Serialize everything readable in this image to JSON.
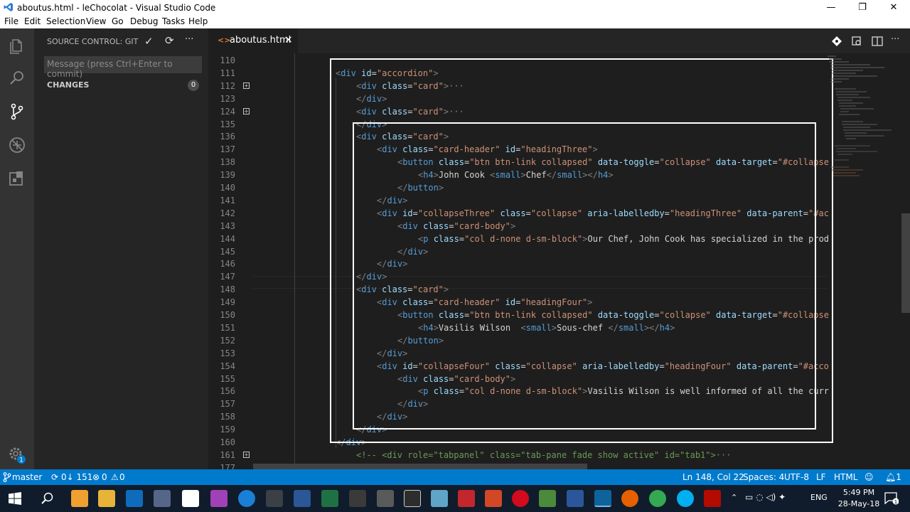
{
  "window": {
    "title": "aboutus.html - leChocolat - Visual Studio Code",
    "minimize": "—",
    "maximize": "❐",
    "close": "✕"
  },
  "menu": [
    "File",
    "Edit",
    "Selection",
    "View",
    "Go",
    "Debug",
    "Tasks",
    "Help"
  ],
  "sidebar": {
    "header": "SOURCE CONTROL: GIT",
    "commit_placeholder": "Message (press Ctrl+Enter to commit)",
    "changes_label": "CHANGES",
    "changes_count": "0",
    "check_glyph": "✓",
    "refresh_glyph": "⟳",
    "more_glyph": "···"
  },
  "tab": {
    "icon": "<>",
    "label": "aboutus.html",
    "close": "×"
  },
  "editor": {
    "lines": [
      {
        "n": "110",
        "indent": 0,
        "parts": []
      },
      {
        "n": "111",
        "indent": 0,
        "parts": [
          [
            "pu",
            "<"
          ],
          [
            "tg",
            "div"
          ],
          [
            "tx",
            " "
          ],
          [
            "at",
            "id"
          ],
          [
            "tx",
            "="
          ],
          [
            "st",
            "\"accordion\""
          ],
          [
            "pu",
            ">"
          ]
        ]
      },
      {
        "n": "112",
        "indent": 1,
        "fold": true,
        "parts": [
          [
            "pu",
            "<"
          ],
          [
            "tg",
            "div"
          ],
          [
            "tx",
            " "
          ],
          [
            "at",
            "class"
          ],
          [
            "tx",
            "="
          ],
          [
            "st",
            "\"card\""
          ],
          [
            "pu",
            ">"
          ],
          [
            "pu",
            "···"
          ]
        ]
      },
      {
        "n": "123",
        "indent": 1,
        "parts": [
          [
            "pu",
            "</"
          ],
          [
            "tg",
            "div"
          ],
          [
            "pu",
            ">"
          ]
        ]
      },
      {
        "n": "124",
        "indent": 1,
        "fold": true,
        "parts": [
          [
            "pu",
            "<"
          ],
          [
            "tg",
            "div"
          ],
          [
            "tx",
            " "
          ],
          [
            "at",
            "class"
          ],
          [
            "tx",
            "="
          ],
          [
            "st",
            "\"card\""
          ],
          [
            "pu",
            ">"
          ],
          [
            "pu",
            "···"
          ]
        ]
      },
      {
        "n": "135",
        "indent": 1,
        "parts": [
          [
            "pu",
            "</"
          ],
          [
            "tg",
            "div"
          ],
          [
            "pu",
            ">"
          ]
        ]
      },
      {
        "n": "136",
        "indent": 1,
        "parts": [
          [
            "pu",
            "<"
          ],
          [
            "tg",
            "div"
          ],
          [
            "tx",
            " "
          ],
          [
            "at",
            "class"
          ],
          [
            "tx",
            "="
          ],
          [
            "st",
            "\"card\""
          ],
          [
            "pu",
            ">"
          ]
        ]
      },
      {
        "n": "137",
        "indent": 2,
        "parts": [
          [
            "pu",
            "<"
          ],
          [
            "tg",
            "div"
          ],
          [
            "tx",
            " "
          ],
          [
            "at",
            "class"
          ],
          [
            "tx",
            "="
          ],
          [
            "st",
            "\"card-header\""
          ],
          [
            "tx",
            " "
          ],
          [
            "at",
            "id"
          ],
          [
            "tx",
            "="
          ],
          [
            "st",
            "\"headingThree\""
          ],
          [
            "pu",
            ">"
          ]
        ]
      },
      {
        "n": "138",
        "indent": 3,
        "parts": [
          [
            "pu",
            "<"
          ],
          [
            "tg",
            "button"
          ],
          [
            "tx",
            " "
          ],
          [
            "at",
            "class"
          ],
          [
            "tx",
            "="
          ],
          [
            "st",
            "\"btn btn-link collapsed\""
          ],
          [
            "tx",
            " "
          ],
          [
            "at",
            "data-toggle"
          ],
          [
            "tx",
            "="
          ],
          [
            "st",
            "\"collapse\""
          ],
          [
            "tx",
            " "
          ],
          [
            "at",
            "data-target"
          ],
          [
            "tx",
            "="
          ],
          [
            "st",
            "\"#collapse"
          ]
        ]
      },
      {
        "n": "139",
        "indent": 4,
        "parts": [
          [
            "pu",
            "<"
          ],
          [
            "tg",
            "h4"
          ],
          [
            "pu",
            ">"
          ],
          [
            "tx",
            "John Cook "
          ],
          [
            "pu",
            "<"
          ],
          [
            "tg",
            "small"
          ],
          [
            "pu",
            ">"
          ],
          [
            "tx",
            "Chef"
          ],
          [
            "pu",
            "</"
          ],
          [
            "tg",
            "small"
          ],
          [
            "pu",
            "></"
          ],
          [
            "tg",
            "h4"
          ],
          [
            "pu",
            ">"
          ]
        ]
      },
      {
        "n": "140",
        "indent": 3,
        "parts": [
          [
            "pu",
            "</"
          ],
          [
            "tg",
            "button"
          ],
          [
            "pu",
            ">"
          ]
        ]
      },
      {
        "n": "141",
        "indent": 2,
        "parts": [
          [
            "pu",
            "</"
          ],
          [
            "tg",
            "div"
          ],
          [
            "pu",
            ">"
          ]
        ]
      },
      {
        "n": "142",
        "indent": 2,
        "parts": [
          [
            "pu",
            "<"
          ],
          [
            "tg",
            "div"
          ],
          [
            "tx",
            " "
          ],
          [
            "at",
            "id"
          ],
          [
            "tx",
            "="
          ],
          [
            "st",
            "\"collapseThree\""
          ],
          [
            "tx",
            " "
          ],
          [
            "at",
            "class"
          ],
          [
            "tx",
            "="
          ],
          [
            "st",
            "\"collapse\""
          ],
          [
            "tx",
            " "
          ],
          [
            "at",
            "aria-labelledby"
          ],
          [
            "tx",
            "="
          ],
          [
            "st",
            "\"headingThree\""
          ],
          [
            "tx",
            " "
          ],
          [
            "at",
            "data-parent"
          ],
          [
            "tx",
            "="
          ],
          [
            "st",
            "\"#ac"
          ]
        ]
      },
      {
        "n": "143",
        "indent": 3,
        "parts": [
          [
            "pu",
            "<"
          ],
          [
            "tg",
            "div"
          ],
          [
            "tx",
            " "
          ],
          [
            "at",
            "class"
          ],
          [
            "tx",
            "="
          ],
          [
            "st",
            "\"card-body\""
          ],
          [
            "pu",
            ">"
          ]
        ]
      },
      {
        "n": "144",
        "indent": 4,
        "parts": [
          [
            "pu",
            "<"
          ],
          [
            "tg",
            "p"
          ],
          [
            "tx",
            " "
          ],
          [
            "at",
            "class"
          ],
          [
            "tx",
            "="
          ],
          [
            "st",
            "\"col d-none d-sm-block\""
          ],
          [
            "pu",
            ">"
          ],
          [
            "tx",
            "Our Chef, John Cook has specialized in the prod"
          ]
        ]
      },
      {
        "n": "145",
        "indent": 3,
        "parts": [
          [
            "pu",
            "</"
          ],
          [
            "tg",
            "div"
          ],
          [
            "pu",
            ">"
          ]
        ]
      },
      {
        "n": "146",
        "indent": 2,
        "parts": [
          [
            "pu",
            "</"
          ],
          [
            "tg",
            "div"
          ],
          [
            "pu",
            ">"
          ]
        ]
      },
      {
        "n": "147",
        "indent": 1,
        "parts": [
          [
            "pu",
            "</"
          ],
          [
            "tg",
            "div"
          ],
          [
            "pu",
            ">"
          ]
        ]
      },
      {
        "n": "148",
        "indent": 1,
        "parts": [
          [
            "pu",
            "<"
          ],
          [
            "tg",
            "div"
          ],
          [
            "tx",
            " "
          ],
          [
            "at",
            "class"
          ],
          [
            "tx",
            "="
          ],
          [
            "st",
            "\"card\""
          ],
          [
            "pu",
            ">"
          ]
        ]
      },
      {
        "n": "149",
        "indent": 2,
        "parts": [
          [
            "pu",
            "<"
          ],
          [
            "tg",
            "div"
          ],
          [
            "tx",
            " "
          ],
          [
            "at",
            "class"
          ],
          [
            "tx",
            "="
          ],
          [
            "st",
            "\"card-header\""
          ],
          [
            "tx",
            " "
          ],
          [
            "at",
            "id"
          ],
          [
            "tx",
            "="
          ],
          [
            "st",
            "\"headingFour\""
          ],
          [
            "pu",
            ">"
          ]
        ]
      },
      {
        "n": "150",
        "indent": 3,
        "parts": [
          [
            "pu",
            "<"
          ],
          [
            "tg",
            "button"
          ],
          [
            "tx",
            " "
          ],
          [
            "at",
            "class"
          ],
          [
            "tx",
            "="
          ],
          [
            "st",
            "\"btn btn-link collapsed\""
          ],
          [
            "tx",
            " "
          ],
          [
            "at",
            "data-toggle"
          ],
          [
            "tx",
            "="
          ],
          [
            "st",
            "\"collapse\""
          ],
          [
            "tx",
            " "
          ],
          [
            "at",
            "data-target"
          ],
          [
            "tx",
            "="
          ],
          [
            "st",
            "\"#collapse"
          ]
        ]
      },
      {
        "n": "151",
        "indent": 4,
        "parts": [
          [
            "pu",
            "<"
          ],
          [
            "tg",
            "h4"
          ],
          [
            "pu",
            ">"
          ],
          [
            "tx",
            "Vasilis Wilson  "
          ],
          [
            "pu",
            "<"
          ],
          [
            "tg",
            "small"
          ],
          [
            "pu",
            ">"
          ],
          [
            "tx",
            "Sous-chef "
          ],
          [
            "pu",
            "</"
          ],
          [
            "tg",
            "small"
          ],
          [
            "pu",
            "></"
          ],
          [
            "tg",
            "h4"
          ],
          [
            "pu",
            ">"
          ]
        ]
      },
      {
        "n": "152",
        "indent": 3,
        "parts": [
          [
            "pu",
            "</"
          ],
          [
            "tg",
            "button"
          ],
          [
            "pu",
            ">"
          ]
        ]
      },
      {
        "n": "153",
        "indent": 2,
        "parts": [
          [
            "pu",
            "</"
          ],
          [
            "tg",
            "div"
          ],
          [
            "pu",
            ">"
          ]
        ]
      },
      {
        "n": "154",
        "indent": 2,
        "parts": [
          [
            "pu",
            "<"
          ],
          [
            "tg",
            "div"
          ],
          [
            "tx",
            " "
          ],
          [
            "at",
            "id"
          ],
          [
            "tx",
            "="
          ],
          [
            "st",
            "\"collapseFour\""
          ],
          [
            "tx",
            " "
          ],
          [
            "at",
            "class"
          ],
          [
            "tx",
            "="
          ],
          [
            "st",
            "\"collapse\""
          ],
          [
            "tx",
            " "
          ],
          [
            "at",
            "aria-labelledby"
          ],
          [
            "tx",
            "="
          ],
          [
            "st",
            "\"headingFour\""
          ],
          [
            "tx",
            " "
          ],
          [
            "at",
            "data-parent"
          ],
          [
            "tx",
            "="
          ],
          [
            "st",
            "\"#acco"
          ]
        ]
      },
      {
        "n": "155",
        "indent": 3,
        "parts": [
          [
            "pu",
            "<"
          ],
          [
            "tg",
            "div"
          ],
          [
            "tx",
            " "
          ],
          [
            "at",
            "class"
          ],
          [
            "tx",
            "="
          ],
          [
            "st",
            "\"card-body\""
          ],
          [
            "pu",
            ">"
          ]
        ]
      },
      {
        "n": "156",
        "indent": 4,
        "parts": [
          [
            "pu",
            "<"
          ],
          [
            "tg",
            "p"
          ],
          [
            "tx",
            " "
          ],
          [
            "at",
            "class"
          ],
          [
            "tx",
            "="
          ],
          [
            "st",
            "\"col d-none d-sm-block\""
          ],
          [
            "pu",
            ">"
          ],
          [
            "tx",
            "Vasilis Wilson is well informed of all the curr"
          ]
        ]
      },
      {
        "n": "157",
        "indent": 3,
        "parts": [
          [
            "pu",
            "</"
          ],
          [
            "tg",
            "div"
          ],
          [
            "pu",
            ">"
          ]
        ]
      },
      {
        "n": "158",
        "indent": 2,
        "parts": [
          [
            "pu",
            "</"
          ],
          [
            "tg",
            "div"
          ],
          [
            "pu",
            ">"
          ]
        ]
      },
      {
        "n": "159",
        "indent": 1,
        "parts": [
          [
            "pu",
            "</"
          ],
          [
            "tg",
            "div"
          ],
          [
            "pu",
            ">"
          ]
        ]
      },
      {
        "n": "160",
        "indent": 0,
        "parts": [
          [
            "pu",
            "</"
          ],
          [
            "tg",
            "div"
          ],
          [
            "pu",
            ">"
          ]
        ]
      },
      {
        "n": "161",
        "indent": 1,
        "fold": true,
        "parts": [
          [
            "cm",
            "<!-- <div role=\"tabpanel\" class=\"tab-pane fade show active\" id=\"tab1\">"
          ],
          [
            "pu",
            "···"
          ]
        ]
      },
      {
        "n": "177",
        "indent": 0,
        "parts": []
      }
    ]
  },
  "statusbar": {
    "branch": "master",
    "sync": "0↓ 151",
    "problems": "0",
    "warnings": "0",
    "position": "Ln 148, Col 22",
    "spaces": "Spaces: 4",
    "encoding": "UTF-8",
    "eol": "LF",
    "language": "HTML"
  },
  "taskbar": {
    "time": "5:49 PM",
    "date": "28-May-18",
    "lang": "ENG"
  },
  "colors": {
    "accent": "#007acc",
    "selection_box": "#ffffff"
  }
}
